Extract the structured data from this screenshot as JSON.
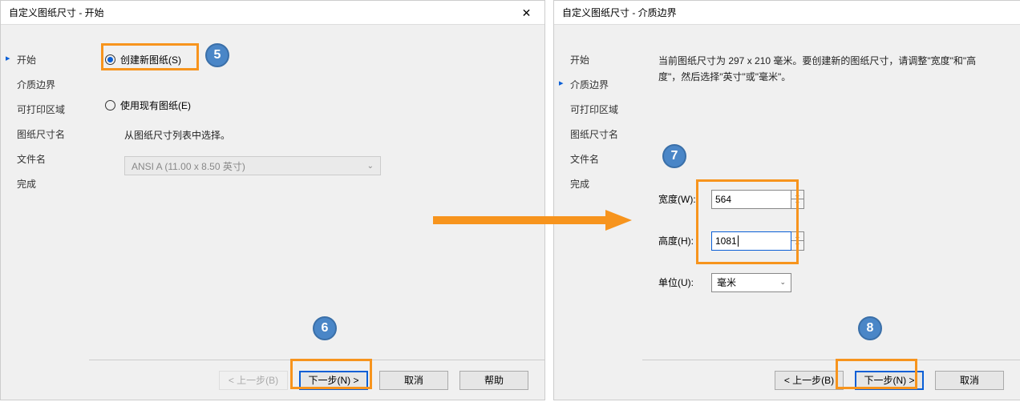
{
  "left": {
    "title": "自定义图纸尺寸 - 开始",
    "sidebar": [
      "开始",
      "介质边界",
      "可打印区域",
      "图纸尺寸名",
      "文件名",
      "完成"
    ],
    "active_index": 0,
    "radio1": "创建新图纸(S)",
    "radio2": "使用现有图纸(E)",
    "hint": "从图纸尺寸列表中选择。",
    "dropdown": "ANSI A (11.00 x 8.50 英寸)",
    "buttons": {
      "back": "< 上一步(B)",
      "next": "下一步(N) >",
      "cancel": "取消",
      "help": "帮助"
    }
  },
  "right": {
    "title": "自定义图纸尺寸 - 介质边界",
    "sidebar": [
      "开始",
      "介质边界",
      "可打印区域",
      "图纸尺寸名",
      "文件名",
      "完成"
    ],
    "active_index": 1,
    "desc": "当前图纸尺寸为 297 x 210 毫米。要创建新的图纸尺寸，请调整\"宽度\"和\"高度\"，然后选择\"英寸\"或\"毫米\"。",
    "width_label": "宽度(W):",
    "width_value": "564",
    "height_label": "高度(H):",
    "height_value": "1081",
    "unit_label": "单位(U):",
    "unit_value": "毫米",
    "buttons": {
      "back": "< 上一步(B)",
      "next": "下一步(N) >",
      "cancel": "取消"
    }
  },
  "annotations": {
    "n5": "5",
    "n6": "6",
    "n7": "7",
    "n8": "8"
  }
}
